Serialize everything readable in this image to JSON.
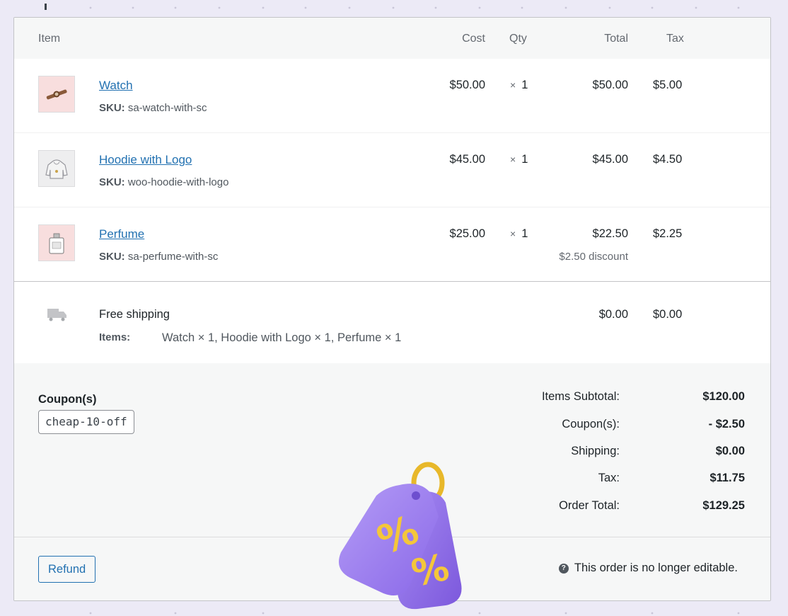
{
  "table": {
    "headers": {
      "item": "Item",
      "cost": "Cost",
      "qty": "Qty",
      "total": "Total",
      "tax": "Tax"
    },
    "sku_label": "SKU:",
    "qty_prefix": "×",
    "items": [
      {
        "name": "Watch",
        "sku": "sa-watch-with-sc",
        "cost": "$50.00",
        "qty": "1",
        "total": "$50.00",
        "tax": "$5.00",
        "discount": "",
        "thumb_icon": "watch-icon"
      },
      {
        "name": "Hoodie with Logo",
        "sku": "woo-hoodie-with-logo",
        "cost": "$45.00",
        "qty": "1",
        "total": "$45.00",
        "tax": "$4.50",
        "discount": "",
        "thumb_icon": "hoodie-icon"
      },
      {
        "name": "Perfume",
        "sku": "sa-perfume-with-sc",
        "cost": "$25.00",
        "qty": "1",
        "total": "$22.50",
        "tax": "$2.25",
        "discount": "$2.50 discount",
        "thumb_icon": "perfume-icon"
      }
    ]
  },
  "shipping": {
    "method": "Free shipping",
    "items_label": "Items:",
    "items_value": "Watch × 1, Hoodie with Logo × 1, Perfume × 1",
    "total": "$0.00",
    "tax": "$0.00",
    "icon": "truck-icon"
  },
  "coupons": {
    "title": "Coupon(s)",
    "codes": [
      "cheap-10-off"
    ]
  },
  "totals": [
    {
      "label": "Items Subtotal:",
      "value": "$120.00"
    },
    {
      "label": "Coupon(s):",
      "value": "- $2.50"
    },
    {
      "label": "Shipping:",
      "value": "$0.00"
    },
    {
      "label": "Tax:",
      "value": "$11.75"
    },
    {
      "label": "Order Total:",
      "value": "$129.25"
    }
  ],
  "footer": {
    "refund_label": "Refund",
    "notice": "This order is no longer editable.",
    "notice_icon": "question-icon"
  },
  "colors": {
    "link": "#2271b1",
    "tag_purple": "#9b7cf0",
    "tag_gold": "#f2c230"
  }
}
